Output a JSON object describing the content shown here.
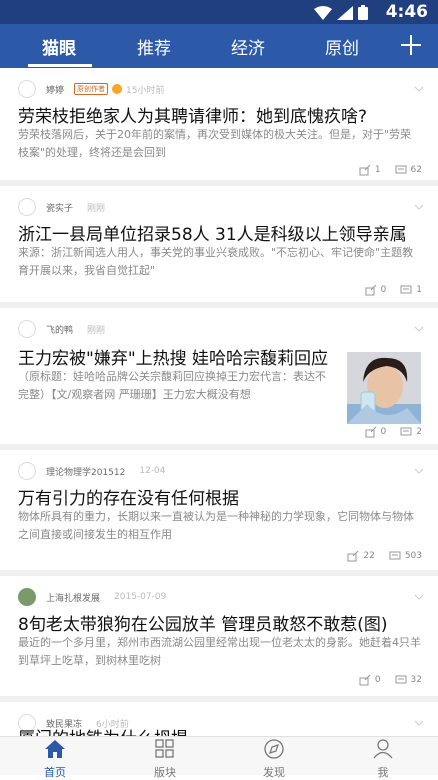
{
  "status_bar": {
    "time": "4:46"
  },
  "nav": {
    "tabs": [
      {
        "label": "猫眼",
        "active": true
      },
      {
        "label": "推荐",
        "active": false
      },
      {
        "label": "经济",
        "active": false
      },
      {
        "label": "原创",
        "active": false
      }
    ],
    "add_icon": "plus-icon"
  },
  "feed": [
    {
      "author": "婷婷",
      "badge": "原创作者",
      "time": "15小时前",
      "title": "劳荣枝拒绝家人为其聘请律师：她到底愧疚啥?",
      "summary": "劳荣枝落网后，关于20年前的案情，再次受到媒体的极大关注。但是，对于\"劳荣枝案\"的处理，终将还是会回到",
      "shares": "1",
      "comments": "62"
    },
    {
      "author": "瓷实子",
      "time": "刚刚",
      "title": "浙江一县局单位招录58人 31人是科级以上领导亲属",
      "summary": "来源：浙江新闻选人用人，事关党的事业兴衰成败。\"不忘初心、牢记使命\"主题教育开展以来，我省自觉扛起\"",
      "shares": "0",
      "comments": "1"
    },
    {
      "author": "飞的鸭",
      "time": "刚刚",
      "title": "王力宏被\"嫌弃\"上热搜 娃哈哈宗馥莉回应",
      "summary": "（原标题：娃哈哈品牌公关宗馥莉回应换掉王力宏代言：表达不完整）【文/观察者网 严珊珊】王力宏大概没有想",
      "shares": "0",
      "comments": "2"
    },
    {
      "author": "理论物理学201512",
      "time": "12-04",
      "title": "万有引力的存在没有任何根据",
      "summary": "物体所具有的重力，长期以来一直被认为是一种神秘的力学现象，它同物体与物体之间直接或间接发生的相互作用",
      "shares": "22",
      "comments": "503"
    },
    {
      "author": "上海扎根发展",
      "time": "2015-07-09",
      "title": " 8旬老太带狼狗在公园放羊 管理员敢怒不敢惹(图)",
      "summary": "最近的一个多月里，郑州市西流湖公园里经常出现一位老太太的身影。她赶着4只羊到草坪上吃草，到树林里吃树",
      "shares": "0",
      "comments": "32"
    },
    {
      "author": "致民果冻",
      "time": "6小时前",
      "title": "厦门的地铁为什么坍塌"
    }
  ],
  "tabbar": [
    {
      "label": "首页",
      "icon": "home-icon",
      "active": true
    },
    {
      "label": "版块",
      "icon": "grid-icon",
      "active": false
    },
    {
      "label": "发现",
      "icon": "compass-icon",
      "active": false
    },
    {
      "label": "我",
      "icon": "user-icon",
      "active": false
    }
  ]
}
